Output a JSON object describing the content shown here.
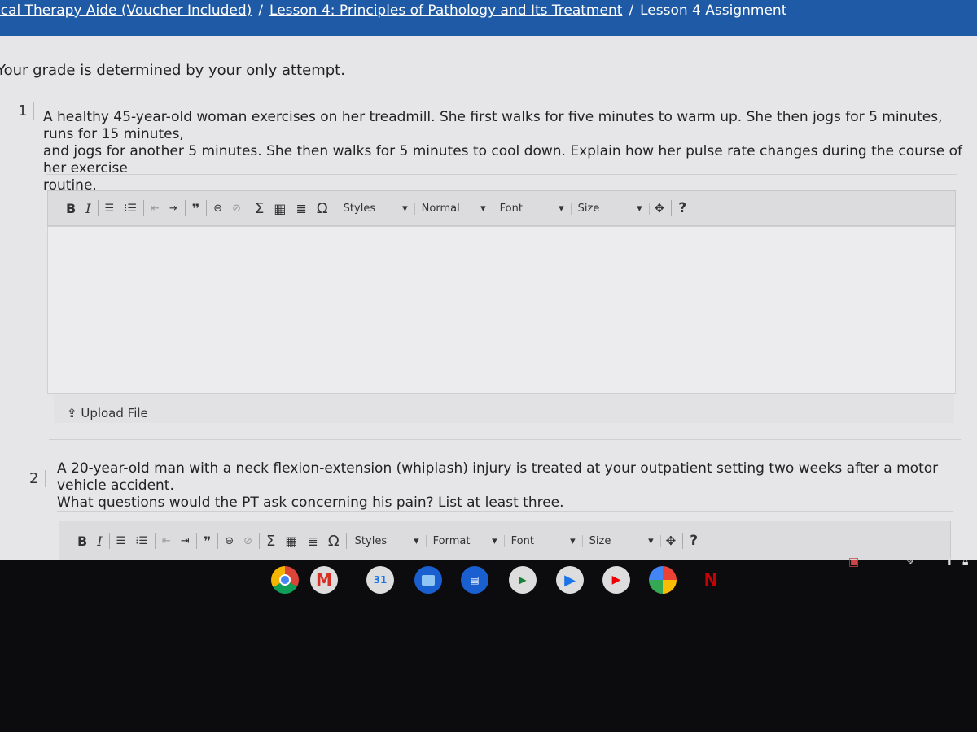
{
  "breadcrumb": {
    "items": [
      "ical Therapy Aide (Voucher Included)",
      "Lesson 4: Principles of Pathology and Its Treatment"
    ],
    "current": "Lesson 4 Assignment",
    "separator": "/"
  },
  "grade_note": "Your grade is determined by your only attempt.",
  "questions": [
    {
      "number": "1",
      "lines": [
        "A healthy 45-year-old woman exercises on her treadmill. She first walks for five minutes to warm up. She then jogs for 5 minutes, runs for 15 minutes,",
        "and jogs for another 5 minutes. She then walks for 5 minutes to cool down. Explain how her pulse rate changes during the course of her exercise",
        "routine."
      ]
    },
    {
      "number": "2",
      "lines": [
        "A 20-year-old man with a neck flexion-extension (whiplash) injury is treated at your outpatient setting two weeks after a motor vehicle accident.",
        "What questions would the PT ask concerning his pain? List at least three."
      ]
    }
  ],
  "toolbar1": {
    "bold": "B",
    "italic": "I",
    "quote": "❞",
    "sigma": "Σ",
    "omega": "Ω",
    "styles": "Styles",
    "format": "Normal",
    "font": "Font",
    "size": "Size",
    "help": "?"
  },
  "toolbar2": {
    "bold": "B",
    "italic": "I",
    "quote": "❞",
    "sigma": "Σ",
    "omega": "Ω",
    "styles": "Styles",
    "format": "Format",
    "font": "Font",
    "size": "Size",
    "help": "?"
  },
  "upload_label": "⇪ Upload File",
  "shelf": {
    "apps": [
      "chrome",
      "gmail",
      "calendar",
      "files",
      "messages",
      "meet",
      "play-store",
      "youtube",
      "photos",
      "netflix"
    ],
    "calendar_day": "31",
    "netflix_letter": "N"
  },
  "colors": {
    "header": "#1f5aa6",
    "page": "#e6e6e8",
    "shelf": "#0c0c0f"
  }
}
